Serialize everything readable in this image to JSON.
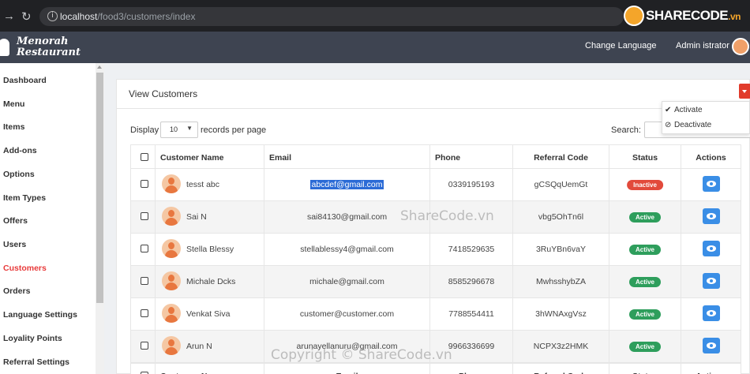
{
  "browser": {
    "back_icon": "arrow-right",
    "reload_icon": "reload",
    "url_host": "localhost",
    "url_path": "/food3/customers/index",
    "watermark_logo": "SHARECODE",
    "watermark_logo_suffix": ".vn"
  },
  "header": {
    "brand_line1": "Menorah",
    "brand_line2": "Restaurant",
    "change_language": "Change Language",
    "admin_name": "Admin istrator"
  },
  "sidebar": {
    "items": [
      {
        "label": "Dashboard"
      },
      {
        "label": "Menu"
      },
      {
        "label": "Items"
      },
      {
        "label": "Add-ons"
      },
      {
        "label": "Options"
      },
      {
        "label": "Item Types"
      },
      {
        "label": "Offers"
      },
      {
        "label": "Users"
      },
      {
        "label": "Customers"
      },
      {
        "label": "Orders"
      },
      {
        "label": "Language Settings"
      },
      {
        "label": "Loyality Points"
      },
      {
        "label": "Referral Settings"
      }
    ],
    "active_color": "#e83a3a"
  },
  "card": {
    "title": "View Customers",
    "display_label": "Display",
    "per_page_value": "10",
    "per_page_suffix": "records per page",
    "search_label": "Search:"
  },
  "dropdown": {
    "activate": "Activate",
    "deactivate": "Deactivate"
  },
  "table": {
    "columns": {
      "name": "Customer Name",
      "email": "Email",
      "phone": "Phone",
      "referral": "Referral Code",
      "status": "Status",
      "actions": "Actions"
    },
    "rows": [
      {
        "name": "tesst abc",
        "email": "abcdef@gmail.com",
        "phone": "0339195193",
        "referral": "gCSQqUemGt",
        "status": "Inactive"
      },
      {
        "name": "Sai N",
        "email": "sai84130@gmail.com",
        "phone": "",
        "referral": "vbg5OhTn6l",
        "status": "Active"
      },
      {
        "name": "Stella Blessy",
        "email": "stellablessy4@gmail.com",
        "phone": "7418529635",
        "referral": "3RuYBn6vaY",
        "status": "Active"
      },
      {
        "name": "Michale Dcks",
        "email": "michale@gmail.com",
        "phone": "8585296678",
        "referral": "MwhsshybZA",
        "status": "Active"
      },
      {
        "name": "Venkat Siva",
        "email": "customer@customer.com",
        "phone": "7788554411",
        "referral": "3hWNAxgVsz",
        "status": "Active"
      },
      {
        "name": "Arun N",
        "email": "arunayellanuru@gmail.com",
        "phone": "9966336699",
        "referral": "NCPX3z2HMK",
        "status": "Active"
      }
    ],
    "colors": {
      "active": "#2e9e5c",
      "inactive": "#e24a3b",
      "action": "#3a8ee6"
    }
  },
  "watermarks": {
    "center": "ShareCode.vn",
    "bottom": "Copyright © ShareCode.vn"
  }
}
